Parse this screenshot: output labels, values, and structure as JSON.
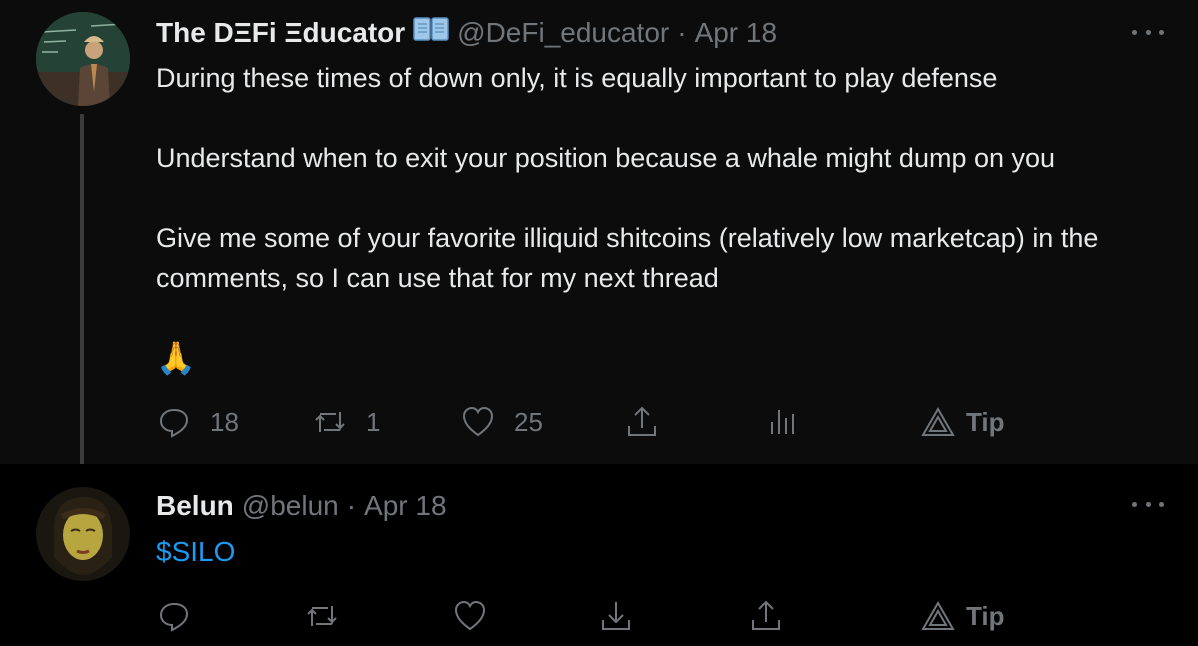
{
  "tweet1": {
    "name": "The DΞFi Ξducator",
    "handle": "@DeFi_educator",
    "separator": "·",
    "date": "Apr 18",
    "paragraphs": [
      "During these times of down only, it is equally important to play defense",
      "Understand when to exit your position because a whale might dump on you",
      "Give me some of your favorite illiquid shitcoins (relatively low marketcap) in the comments, so I can use that for my next thread"
    ],
    "emoji": "🙏",
    "actions": {
      "reply_count": "18",
      "retweet_count": "1",
      "like_count": "25",
      "tip_label": "Tip"
    }
  },
  "tweet2": {
    "name": "Belun",
    "handle": "@belun",
    "separator": "·",
    "date": "Apr 18",
    "text": "$SILO",
    "actions": {
      "tip_label": "Tip"
    }
  },
  "colors": {
    "background": "#000000",
    "tweet_highlight": "#0c0c0c",
    "text": "#e7e9ea",
    "secondary": "#71767b",
    "link": "#1d9bf0"
  },
  "icons": [
    "reply-icon",
    "retweet-icon",
    "like-icon",
    "share-icon",
    "analytics-icon",
    "tip-icon",
    "download-icon",
    "more-icon",
    "book-icon"
  ]
}
